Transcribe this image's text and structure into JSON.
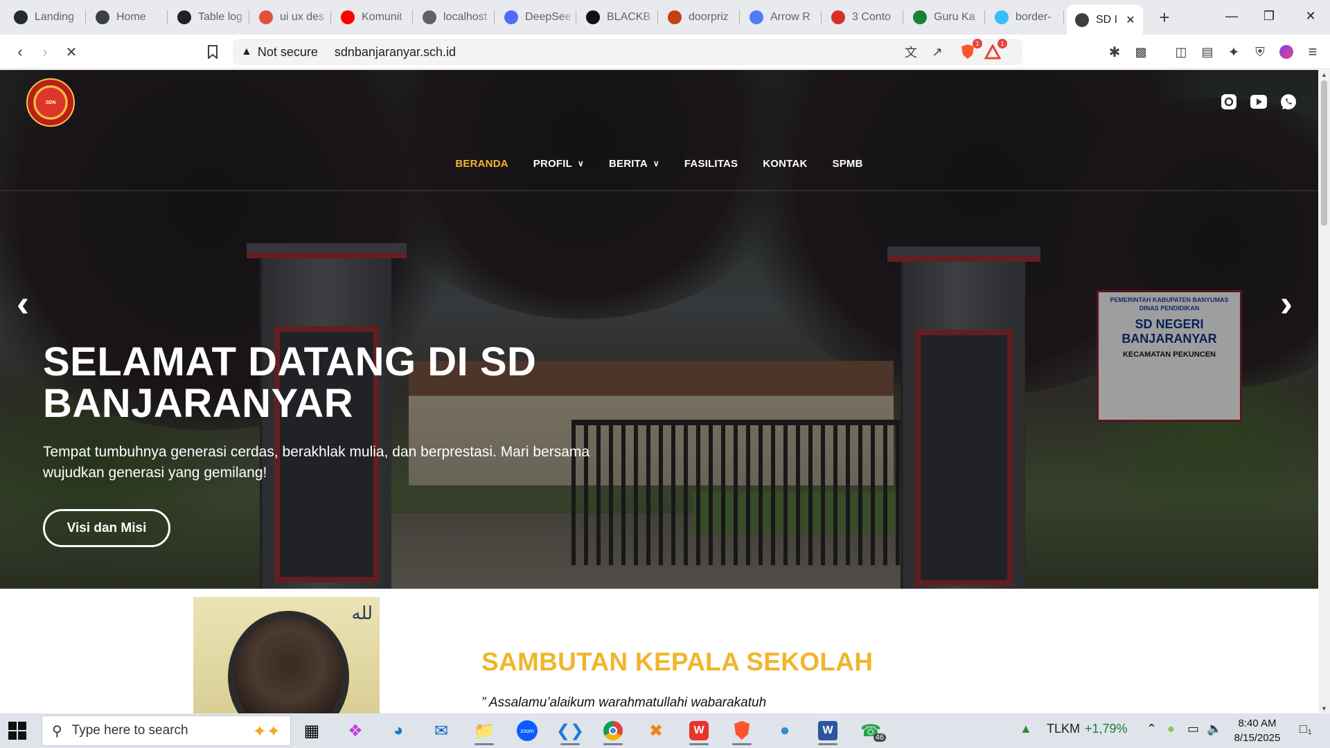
{
  "browser": {
    "tabs": [
      {
        "title": "Landing",
        "icon": "github-icon",
        "color": "#24292f"
      },
      {
        "title": "Home",
        "icon": "globe-icon",
        "color": "#3c4043"
      },
      {
        "title": "Table log",
        "icon": "chatgpt-icon",
        "color": "#202124"
      },
      {
        "title": "ui ux des",
        "icon": "brave-shield-icon",
        "color": "#e0513a"
      },
      {
        "title": "Komunit",
        "icon": "youtube-icon",
        "color": "#ff0000"
      },
      {
        "title": "localhost",
        "icon": "globe-icon",
        "color": "#5f6368"
      },
      {
        "title": "DeepSee",
        "icon": "deepseek-icon",
        "color": "#4d6bfe"
      },
      {
        "title": "BLACKB",
        "icon": "blackbox-icon",
        "color": "#111111"
      },
      {
        "title": "doorpriz",
        "icon": "brave-shield-icon",
        "color": "#c2410c"
      },
      {
        "title": "Arrow R",
        "icon": "arrow-app-icon",
        "color": "#4f7cf7"
      },
      {
        "title": "3 Conto",
        "icon": "alert-icon",
        "color": "#d93025"
      },
      {
        "title": "Guru Ka",
        "icon": "sheet-icon",
        "color": "#188038"
      },
      {
        "title": "border-",
        "icon": "tailwind-icon",
        "color": "#38bdf8"
      },
      {
        "title": "SD I",
        "icon": "loading-icon",
        "color": "#3c4043"
      }
    ],
    "new_tab_glyph": "+",
    "security_label": "Not secure",
    "url": "sdnbanjaranyar.sch.id",
    "brave_badge": "1",
    "rewards_badge": "1"
  },
  "site": {
    "nav": [
      {
        "label": "BERANDA",
        "current": true,
        "dropdown": false
      },
      {
        "label": "PROFIL",
        "current": false,
        "dropdown": true
      },
      {
        "label": "BERITA",
        "current": false,
        "dropdown": true
      },
      {
        "label": "FASILITAS",
        "current": false,
        "dropdown": false
      },
      {
        "label": "KONTAK",
        "current": false,
        "dropdown": false
      },
      {
        "label": "SPMB",
        "current": false,
        "dropdown": false
      }
    ],
    "social": [
      "instagram-icon",
      "youtube-icon",
      "whatsapp-icon"
    ],
    "hero": {
      "title": "SELAMAT DATANG DI SD BANJARANYAR",
      "subtitle": "Tempat tumbuhnya generasi cerdas, berakhlak mulia, dan berprestasi. Mari bersama wujudkan generasi yang gemilang!",
      "button": "Visi dan Misi",
      "sign_top": "PEMERINTAH KABUPATEN BANYUMAS",
      "sign_top2": "DINAS PENDIDIKAN",
      "sign_main": "SD NEGERI BANJARANYAR",
      "sign_sub": "KECAMATAN PEKUNCEN"
    },
    "welcome": {
      "title": "SAMBUTAN KEPALA SEKOLAH",
      "quote": "” Assalamu’alaikum warahmatullahi wabarakatuh"
    },
    "accent_color": "#f0b52b"
  },
  "taskbar": {
    "search_placeholder": "Type here to search",
    "stock_ticker": "TLKM",
    "stock_change": "+1,79%",
    "whatsapp_badge": "46",
    "notification_badge": "1",
    "time": "8:40 AM",
    "date": "8/15/2025"
  }
}
